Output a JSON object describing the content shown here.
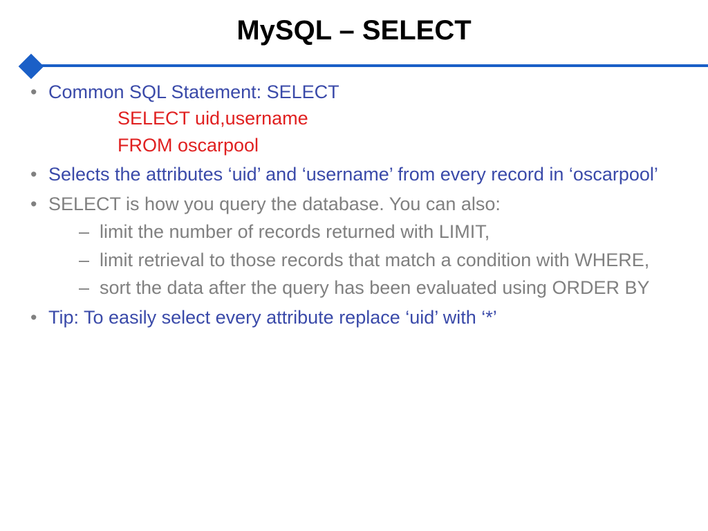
{
  "title": "MySQL – SELECT",
  "bullets": {
    "b1": "Common SQL Statement: SELECT",
    "code1": "SELECT uid,username",
    "code2": "FROM oscarpool",
    "b2": "Selects the attributes ‘uid’ and ‘username’ from every record in ‘oscarpool’",
    "b3": "SELECT is how you query the database. You can also:",
    "s1": "limit the number of records returned with LIMIT,",
    "s2": "limit retrieval to those records that match a condition with WHERE,",
    "s3": "sort the data after the query has been evaluated using ORDER BY",
    "b4": "Tip: To easily select every attribute replace ‘uid’ with ‘*’"
  }
}
